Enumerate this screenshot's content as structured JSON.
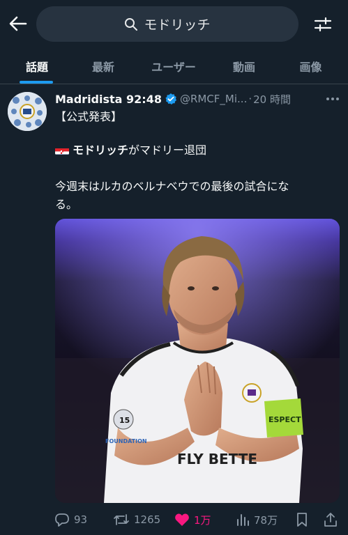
{
  "header": {
    "search_query": "モドリッチ"
  },
  "tabs": [
    {
      "label": "話題",
      "active": true
    },
    {
      "label": "最新",
      "active": false
    },
    {
      "label": "ユーザー",
      "active": false
    },
    {
      "label": "動画",
      "active": false
    },
    {
      "label": "画像",
      "active": false
    }
  ],
  "tweet": {
    "display_name": "Madridista 92:48",
    "handle": "@RMCF_Mi...",
    "separator": "·",
    "time": "20 時間",
    "line1": "【公式発表】",
    "line2_bold": "モドリッチ",
    "line2_rest": "がマドリー退団",
    "line3": "今週末はルカのベルナベウでの最後の試合にな",
    "line4": "る。",
    "image_text": {
      "sleeve_badge": "15",
      "foundation": "FOUNDATION",
      "armband": "ESPECT",
      "sponsor": "FLY BETTE"
    }
  },
  "actions": {
    "replies": "93",
    "retweets": "1265",
    "likes": "1万",
    "views": "78万"
  },
  "colors": {
    "background": "#15202b",
    "accent": "#1d9bf0",
    "like": "#f91880",
    "muted": "#8b98a5"
  },
  "icons": [
    "back-arrow-icon",
    "search-icon",
    "filter-icon",
    "verified-icon",
    "more-icon",
    "reply-icon",
    "retweet-icon",
    "like-icon",
    "views-icon",
    "bookmark-icon",
    "share-icon",
    "croatia-flag-icon"
  ]
}
